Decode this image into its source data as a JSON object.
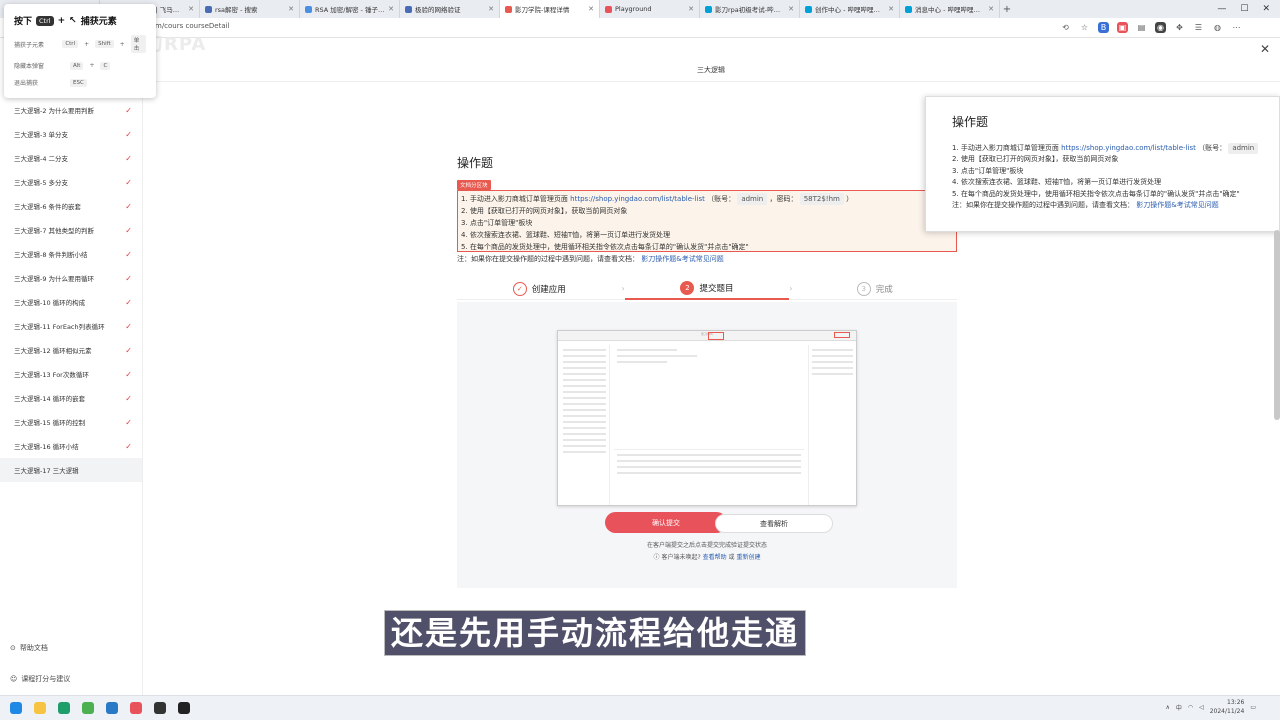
{
  "browser": {
    "tabs": [
      {
        "title": "",
        "active": false,
        "color": "#f0b400"
      },
      {
        "title": "用户Api 文档 | 飞马快验",
        "active": false,
        "color": "#5b8def"
      },
      {
        "title": "rsa解密 - 搜索",
        "active": false,
        "color": "#4a6bb5"
      },
      {
        "title": "RSA 加密/解密 - 锤子在线工具",
        "active": false,
        "color": "#4a90e2"
      },
      {
        "title": "极验的网络验证",
        "active": false,
        "color": "#4a6bb5"
      },
      {
        "title": "影刀学院-课程详情",
        "active": true,
        "color": "#e85a4f"
      },
      {
        "title": "Playground",
        "active": false,
        "color": "#e8525a"
      },
      {
        "title": "影刀rpa初级考试-哔哩哔哩_bilibili",
        "active": false,
        "color": "#00a1d6"
      },
      {
        "title": "创作中心 - 哔哩哔哩弹幕视频网",
        "active": false,
        "color": "#00a1d6"
      },
      {
        "title": "消息中心 - 哔哩哔哩弹幕视频网",
        "active": false,
        "color": "#00a1d6"
      }
    ],
    "new_tab": "+",
    "url": "m/cours  courseDetail",
    "close": "✕"
  },
  "capture_panel": {
    "press": "按下",
    "ctrl_key": "Ctrl",
    "plus": "+",
    "title": "捕获元素",
    "rows": [
      {
        "label": "捕获子元素",
        "keys": [
          "Ctrl",
          "Shift"
        ],
        "extra": "单击"
      },
      {
        "label": "隐藏本弹窗",
        "keys": [
          "Alt",
          "C"
        ],
        "extra": ""
      },
      {
        "label": "退出捕获",
        "keys": [
          "ESC"
        ],
        "extra": ""
      }
    ]
  },
  "watermark": "影刀RPA",
  "page_title": "三大逻辑",
  "sidebar": {
    "items": [
      {
        "label": "三大逻辑-2 为什么要用判断",
        "done": true,
        "active": false
      },
      {
        "label": "三大逻辑-3 单分支",
        "done": true,
        "active": false
      },
      {
        "label": "三大逻辑-4 二分支",
        "done": true,
        "active": false
      },
      {
        "label": "三大逻辑-5 多分支",
        "done": true,
        "active": false
      },
      {
        "label": "三大逻辑-6 条件的嵌套",
        "done": true,
        "active": false
      },
      {
        "label": "三大逻辑-7 其他类型的判断",
        "done": true,
        "active": false
      },
      {
        "label": "三大逻辑-8 条件判断小结",
        "done": true,
        "active": false
      },
      {
        "label": "三大逻辑-9 为什么要用循环",
        "done": true,
        "active": false
      },
      {
        "label": "三大逻辑-10 循环的构成",
        "done": true,
        "active": false
      },
      {
        "label": "三大逻辑-11 ForEach列表循环",
        "done": true,
        "active": false
      },
      {
        "label": "三大逻辑-12 循环相似元素",
        "done": true,
        "active": false
      },
      {
        "label": "三大逻辑-13 For次数循环",
        "done": true,
        "active": false
      },
      {
        "label": "三大逻辑-14 循环的嵌套",
        "done": true,
        "active": false
      },
      {
        "label": "三大逻辑-15 循环的控制",
        "done": true,
        "active": false
      },
      {
        "label": "三大逻辑-16 循环小结",
        "done": true,
        "active": false
      },
      {
        "label": "三大逻辑-17 三大逻辑",
        "done": false,
        "active": true
      }
    ],
    "check": "✓",
    "help": "帮助文档",
    "rate": "课程打分与建议"
  },
  "task": {
    "title": "操作题",
    "badge": "文档分区块",
    "line1_prefix": "1. 手动进入影刀商城订单管理页面",
    "shop_url": "https://shop.yingdao.com/list/table-list",
    "account_label": "（账号：",
    "account": "admin",
    "password_label": "，密码：",
    "password": "58T2$!hm",
    "close_paren": "）",
    "line2": "2. 使用【获取已打开的网页对象】，获取当前网页对象",
    "line3": "3. 点击\"订单管理\"板块",
    "line4": "4. 依次搜索连衣裙、篮球鞋、短袖T恤，将第一页订单进行发货处理",
    "line5": "5. 在每个商品的发货处理中，使用循环相关指令依次点击每条订单的\"确认发货\"并点击\"确定\"",
    "note_prefix": "注：如果你在提交操作题的过程中遇到问题，请查看文档：",
    "note_link": "影刀操作题&考试常见问题"
  },
  "steps": [
    {
      "num": "✓",
      "label": "创建应用",
      "state": "done"
    },
    {
      "num": "2",
      "label": "提交题目",
      "state": "active"
    },
    {
      "num": "3",
      "label": "完成",
      "state": "todo"
    }
  ],
  "step_arrow": "›",
  "preview": {
    "inner_title": "影刀RPA",
    "confirm": "确认提交",
    "analysis": "查看解析",
    "hint1": "在客户端提交之后点击提交完成验证提交状态",
    "hint2_prefix": "客户端未唤起?",
    "hint2_link1": "查看帮助",
    "hint2_or": "或",
    "hint2_link2": "重新创建"
  },
  "popup": {
    "title": "操作题",
    "line1_prefix": "1. 手动进入影刀商城订单管理页面",
    "shop_url": "https://shop.yingdao.com/list/table-list",
    "account_label": "（账号：",
    "account": "admin",
    "line2": "2. 使用【获取已打开的网页对象】，获取当前网页对象",
    "line3": "3. 点击\"订单管理\"板块",
    "line4": "4. 依次搜索连衣裙、篮球鞋、短袖T恤，将第一页订单进行发货处理",
    "line5": "5. 在每个商品的发货处理中，使用循环相关指令依次点击每条订单的\"确认发货\"并点击\"确定\"",
    "note_prefix": "注：如果你在提交操作题的过程中遇到问题，请查看文档：",
    "note_link": "影刀操作题&考试常见问题"
  },
  "subtitle": "还是先用手动流程给他走通",
  "taskbar": {
    "time": "13:26",
    "date": "2024/11/24",
    "lang": "中",
    "icons": [
      {
        "name": "windows",
        "color": "#1e88e5"
      },
      {
        "name": "explorer",
        "color": "#f6c343"
      },
      {
        "name": "edge",
        "color": "#1e9e6a"
      },
      {
        "name": "chrome",
        "color": "#4caf50"
      },
      {
        "name": "vscode",
        "color": "#2979c7"
      },
      {
        "name": "yingdao",
        "color": "#e8525a"
      },
      {
        "name": "app",
        "color": "#333333"
      },
      {
        "name": "terminal",
        "color": "#222222"
      }
    ]
  },
  "colors": {
    "accent": "#e85a4f",
    "link": "#2a5db0"
  }
}
